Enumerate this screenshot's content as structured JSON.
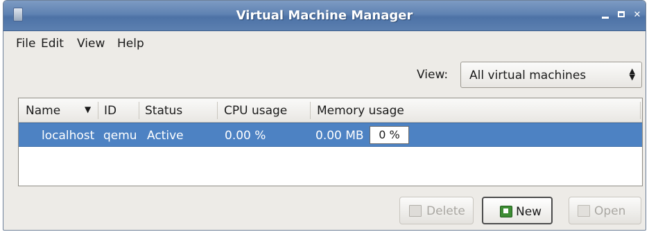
{
  "window": {
    "title": "Virtual Machine Manager"
  },
  "menu": [
    {
      "label": "File"
    },
    {
      "label": "Edit"
    },
    {
      "label": "View"
    },
    {
      "label": "Help"
    }
  ],
  "view_filter": {
    "label": "View:",
    "selected": "All virtual machines"
  },
  "table": {
    "columns": [
      "Name",
      "ID",
      "Status",
      "CPU usage",
      "Memory usage"
    ],
    "rows": [
      {
        "name": "localhost",
        "id": "qemu",
        "status": "Active",
        "cpu": "0.00 %",
        "memory": "0.00 MB",
        "memory_percent": "0 %"
      }
    ]
  },
  "buttons": {
    "delete": "Delete",
    "new": "New",
    "open": "Open"
  },
  "colors": {
    "titlebar": "#5f82b2",
    "selection": "#4d82c3",
    "window_bg": "#edebe7"
  }
}
